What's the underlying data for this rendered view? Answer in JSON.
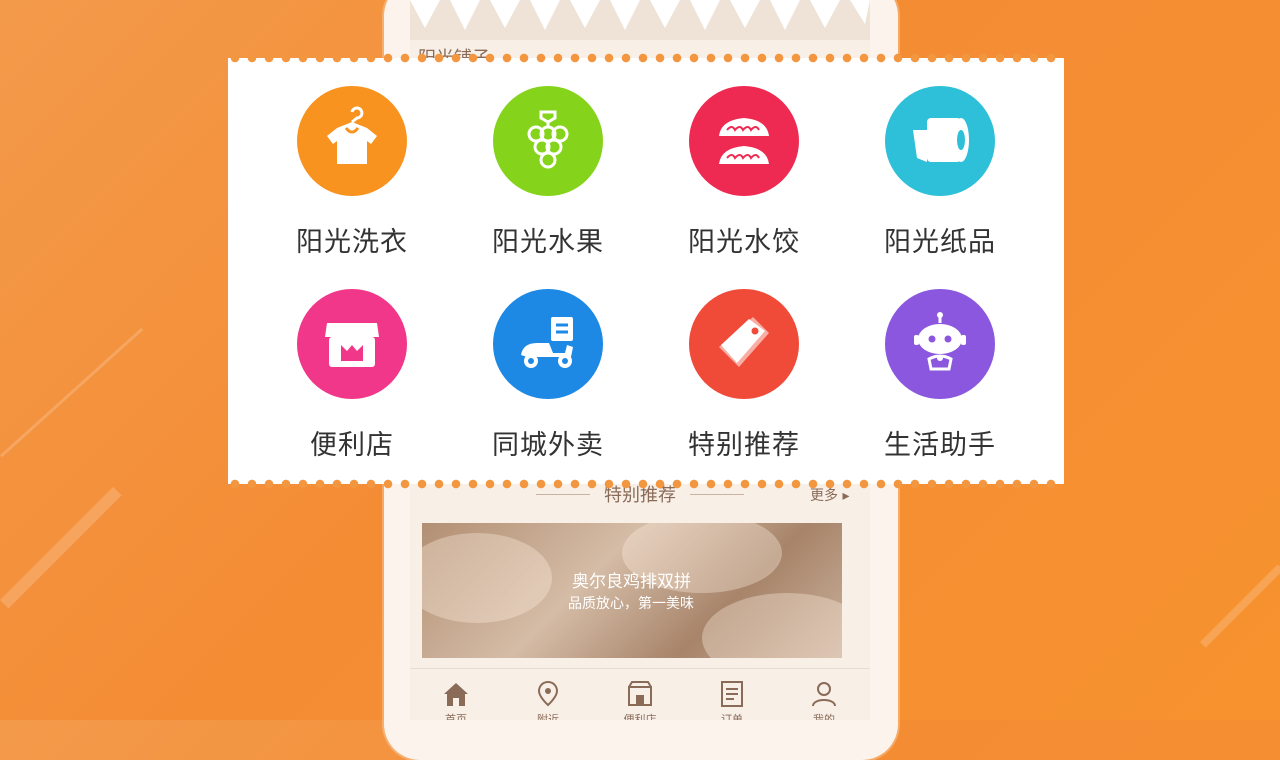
{
  "screen": {
    "header_text": "阳光铺子",
    "section_title": "特别推荐",
    "more_label": "更多 ▸",
    "promo": {
      "title": "奥尔良鸡排双拼",
      "subtitle": "品质放心，第一美味"
    },
    "tabs": [
      {
        "label": "首页",
        "icon": "home-icon"
      },
      {
        "label": "附近",
        "icon": "location-pin-icon"
      },
      {
        "label": "便利店",
        "icon": "store-icon"
      },
      {
        "label": "订单",
        "icon": "order-list-icon"
      },
      {
        "label": "我的",
        "icon": "person-icon"
      }
    ]
  },
  "categories": [
    {
      "label": "阳光洗衣",
      "icon": "shirt-hanger-icon",
      "color": "#f7931e"
    },
    {
      "label": "阳光水果",
      "icon": "grapes-icon",
      "color": "#86d31c"
    },
    {
      "label": "阳光水饺",
      "icon": "dumplings-icon",
      "color": "#ee2a52"
    },
    {
      "label": "阳光纸品",
      "icon": "toilet-paper-icon",
      "color": "#2ec0d8"
    },
    {
      "label": "便利店",
      "icon": "storefront-icon",
      "color": "#f0378a"
    },
    {
      "label": "同城外卖",
      "icon": "delivery-scooter-icon",
      "color": "#1e88e5"
    },
    {
      "label": "特别推荐",
      "icon": "price-tag-icon",
      "color": "#f04a38"
    },
    {
      "label": "生活助手",
      "icon": "robot-assistant-icon",
      "color": "#8a57de"
    }
  ]
}
